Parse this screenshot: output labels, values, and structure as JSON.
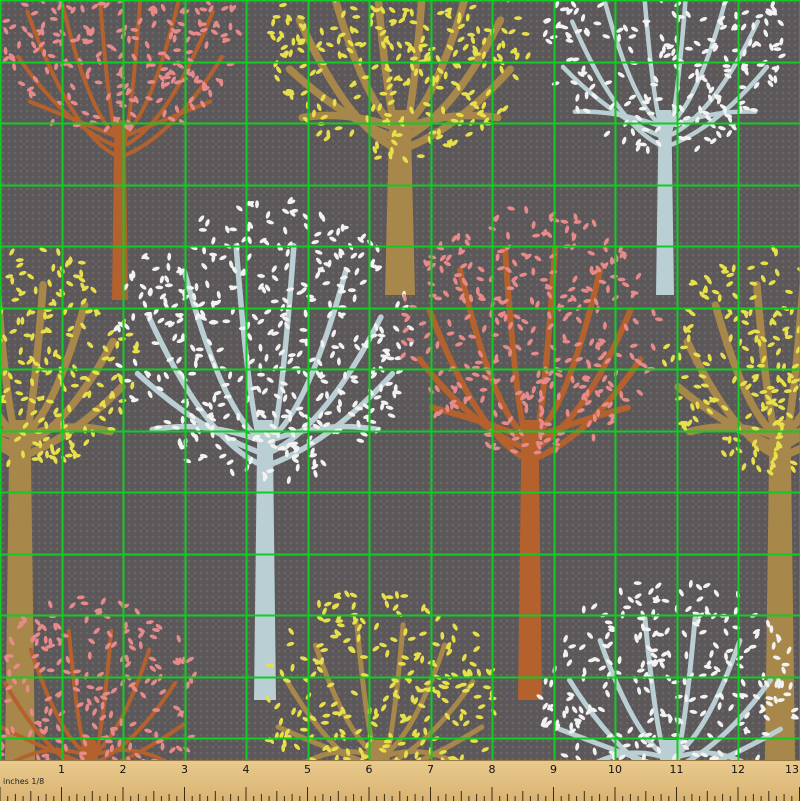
{
  "fabric": {
    "pattern": "stylized trees with small leaves",
    "colors": {
      "background": "#5c5859",
      "background_dot": "#6a6566",
      "grid": "#11cc22",
      "pink_leaves": "#e88a8a",
      "pink_trunk": "#b4612d",
      "yellow_leaves": "#e8e04a",
      "yellow_trunk": "#a8884a",
      "white_leaves": "#f2f2f2",
      "white_trunk": "#b9cfd3"
    }
  },
  "ruler": {
    "unit_label": "inches 1/8",
    "ticks": [
      "1",
      "2",
      "3",
      "4",
      "5",
      "6",
      "7",
      "8",
      "9",
      "10",
      "11",
      "12",
      "13"
    ]
  }
}
